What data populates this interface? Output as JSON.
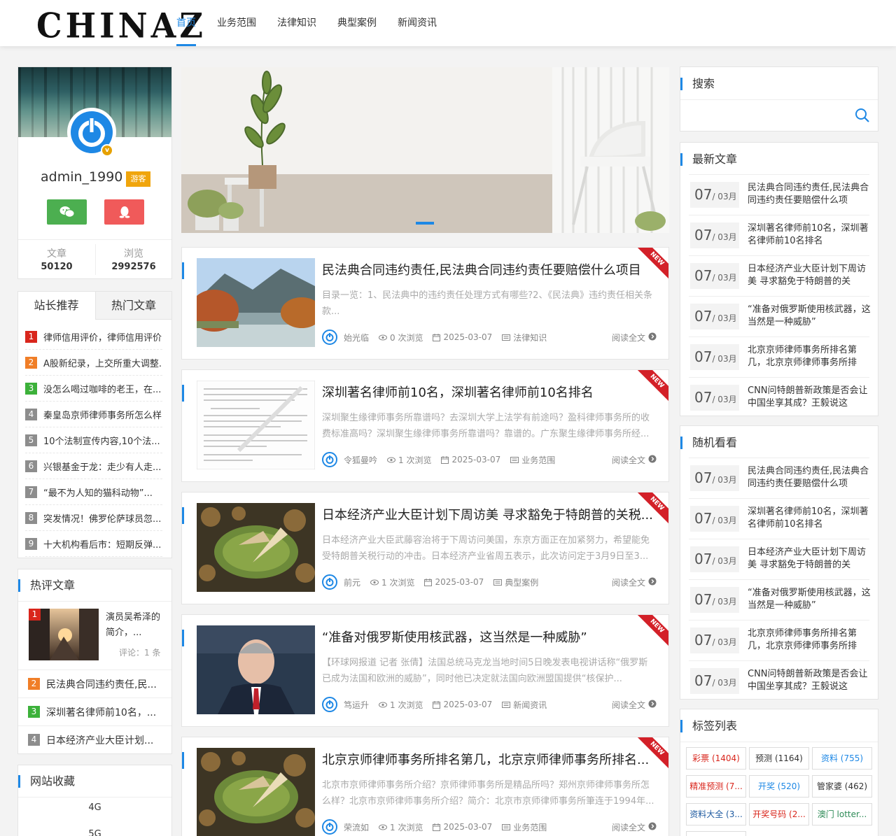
{
  "header": {
    "logo": "CHINAZ",
    "nav": [
      "首页",
      "业务范围",
      "法律知识",
      "典型案例",
      "新闻资讯"
    ]
  },
  "profile": {
    "username": "admin_1990",
    "role_badge": "游客",
    "stats": [
      {
        "label": "文章",
        "value": "50120"
      },
      {
        "label": "浏览",
        "value": "2992576"
      }
    ]
  },
  "rank_tabs": {
    "tabs": [
      "站长推荐",
      "热门文章"
    ],
    "items": [
      {
        "n": "1",
        "text": "律师信用评价，律师信用评价..."
      },
      {
        "n": "2",
        "text": "A股新纪录，上交所重大调整..."
      },
      {
        "n": "3",
        "text": "没怎么喝过咖啡的老王，在..."
      },
      {
        "n": "4",
        "text": "秦皇岛京师律师事务所怎么样..."
      },
      {
        "n": "5",
        "text": "10个法制宣传内容,10个法..."
      },
      {
        "n": "6",
        "text": "兴银基金于龙：走少有人走..."
      },
      {
        "n": "7",
        "text": "“最不为人知的猫科动物”..."
      },
      {
        "n": "8",
        "text": "突发情况！佛罗伦萨球员忽..."
      },
      {
        "n": "9",
        "text": "十大机构看后市：短期反弹..."
      }
    ]
  },
  "hot_comments": {
    "title": "热评文章",
    "top": {
      "n": "1",
      "text": "演员吴希泽的简介，...",
      "comments": "评论：1 条"
    },
    "items": [
      {
        "n": "2",
        "text": "民法典合同违约责任,民..."
      },
      {
        "n": "3",
        "text": "深圳著名律师前10名，..."
      },
      {
        "n": "4",
        "text": "日本经济产业大臣计划..."
      }
    ]
  },
  "favorites": {
    "title": "网站收藏",
    "items": [
      "4G",
      "5G"
    ]
  },
  "articles": [
    {
      "title": "民法典合同违约责任,民法典合同违约责任要赔偿什么项目",
      "excerpt": "目录一览：1、民法典中的违约责任处理方式有哪些?2、《民法典》违约责任相关条款...",
      "author": "始光临",
      "views": "0 次浏览",
      "date": "2025-03-07",
      "category": "法律知识",
      "read": "阅读全文",
      "ribbon": "NEW"
    },
    {
      "title": "深圳著名律师前10名，深圳著名律师前10名排名",
      "excerpt": "深圳聚生缘律师事务所靠谱吗？去深圳大学上法学有前途吗？盈科律师事务所的收费标准高吗？深圳聚生缘律师事务所靠谱吗？靠谱的。广东聚生缘律师事务所经...",
      "author": "令狐曼吟",
      "views": "1 次浏览",
      "date": "2025-03-07",
      "category": "业务范围",
      "read": "阅读全文",
      "ribbon": "NEW"
    },
    {
      "title": "日本经济产业大臣计划下周访美 寻求豁免于特朗普的关税...",
      "excerpt": "日本经济产业大臣武藤容治将于下周访问美国，东京方面正在加紧努力，希望能免受特朗普关税行动的冲击。日本经济产业省周五表示，此次访问定于3月9日至3...",
      "author": "前元",
      "views": "1 次浏览",
      "date": "2025-03-07",
      "category": "典型案例",
      "read": "阅读全文",
      "ribbon": "NEW"
    },
    {
      "title": "“准备对俄罗斯使用核武器，这当然是一种威胁”",
      "excerpt": "【环球网报道 记者 张倩】法国总统马克龙当地时间5日晚发表电视讲话称“俄罗斯已成为法国和欧洲的威胁”，同时他已决定就法国向欧洲盟国提供“核保护...",
      "author": "笃运升",
      "views": "1 次浏览",
      "date": "2025-03-07",
      "category": "新闻资讯",
      "read": "阅读全文",
      "ribbon": "NEW"
    },
    {
      "title": "北京京师律师事务所排名第几，北京京师律师事务所排名...",
      "excerpt": "北京市京师律师事务所介绍？京师律师事务所是精品所吗？郑州京师律师事务所怎么样？北京市京师律师事务所介绍？简介：北京市京师律师事务所筆连于1994年...",
      "author": "荣流如",
      "views": "1 次浏览",
      "date": "2025-03-07",
      "category": "业务范围",
      "read": "阅读全文",
      "ribbon": "NEW"
    }
  ],
  "search": {
    "title": "搜索",
    "placeholder": ""
  },
  "latest": {
    "title": "最新文章",
    "items": [
      {
        "day": "07",
        "month": "/ 03月",
        "text": "民法典合同违约责任,民法典合同违约责任要赔偿什么项"
      },
      {
        "day": "07",
        "month": "/ 03月",
        "text": "深圳著名律师前10名，深圳著名律师前10名排名"
      },
      {
        "day": "07",
        "month": "/ 03月",
        "text": "日本经济产业大臣计划下周访美 寻求豁免于特朗普的关"
      },
      {
        "day": "07",
        "month": "/ 03月",
        "text": "“准备对俄罗斯使用核武器，这当然是一种威胁”"
      },
      {
        "day": "07",
        "month": "/ 03月",
        "text": "北京京师律师事务所排名第几，北京京师律师事务所排"
      },
      {
        "day": "07",
        "month": "/ 03月",
        "text": "CNN问特朗普新政策是否会让中国坐享其成？王毅说这"
      }
    ]
  },
  "random": {
    "title": "随机看看",
    "items": [
      {
        "day": "07",
        "month": "/ 03月",
        "text": "民法典合同违约责任,民法典合同违约责任要赔偿什么项"
      },
      {
        "day": "07",
        "month": "/ 03月",
        "text": "深圳著名律师前10名，深圳著名律师前10名排名"
      },
      {
        "day": "07",
        "month": "/ 03月",
        "text": "日本经济产业大臣计划下周访美 寻求豁免于特朗普的关"
      },
      {
        "day": "07",
        "month": "/ 03月",
        "text": "“准备对俄罗斯使用核武器，这当然是一种威胁”"
      },
      {
        "day": "07",
        "month": "/ 03月",
        "text": "北京京师律师事务所排名第几，北京京师律师事务所排"
      },
      {
        "day": "07",
        "month": "/ 03月",
        "text": "CNN问特朗普新政策是否会让中国坐享其成？王毅说这"
      }
    ]
  },
  "tags": {
    "title": "标签列表",
    "items": [
      {
        "text": "彩票 (1404)",
        "color": "#d9261c"
      },
      {
        "text": "预测 (1164)",
        "color": "#333333"
      },
      {
        "text": "资料 (755)",
        "color": "#1e88e5"
      },
      {
        "text": "精准预测 (7...",
        "color": "#d9261c"
      },
      {
        "text": "开奖 (520)",
        "color": "#1e88e5"
      },
      {
        "text": "管家婆 (462)",
        "color": "#333333"
      },
      {
        "text": "资料大全 (3...",
        "color": "#1e5aa0"
      },
      {
        "text": "开奖号码 (2...",
        "color": "#d9261c"
      },
      {
        "text": "澳门 lotter...",
        "color": "#2e8b57"
      }
    ]
  },
  "colors": {
    "accent": "#1e88e5",
    "wechat": "#4caf50",
    "qq": "#f05a5a",
    "ribbon": "#d32028"
  }
}
